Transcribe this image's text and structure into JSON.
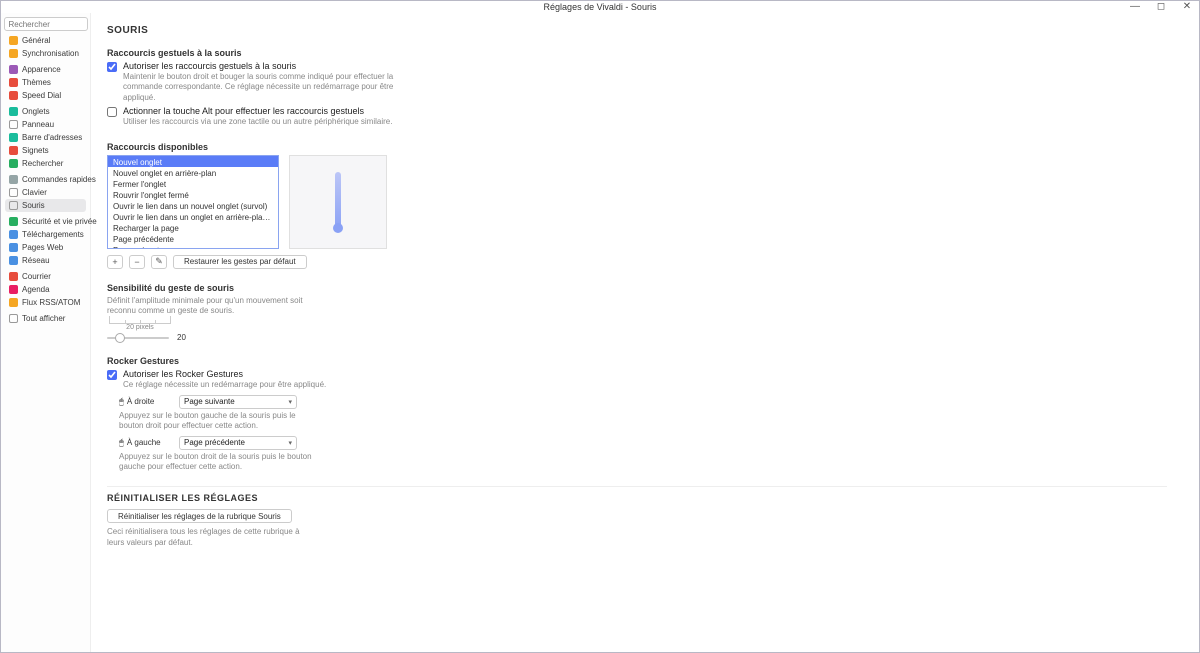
{
  "window": {
    "title": "Réglages de Vivaldi - Souris",
    "min": "—",
    "max": "◻",
    "close": "✕"
  },
  "sidebar": {
    "search_placeholder": "Rechercher",
    "groups": [
      {
        "items": [
          {
            "label": "Général",
            "icon": "ic-orange",
            "name": "general"
          },
          {
            "label": "Synchronisation",
            "icon": "ic-orange",
            "name": "sync"
          }
        ]
      },
      {
        "items": [
          {
            "label": "Apparence",
            "icon": "ic-purple",
            "name": "appearance"
          },
          {
            "label": "Thèmes",
            "icon": "ic-red",
            "name": "themes"
          },
          {
            "label": "Speed Dial",
            "icon": "ic-red",
            "name": "speed-dial"
          }
        ]
      },
      {
        "items": [
          {
            "label": "Onglets",
            "icon": "ic-teal",
            "name": "tabs"
          },
          {
            "label": "Panneau",
            "icon": "ic-outline",
            "name": "panel"
          },
          {
            "label": "Barre d'adresses",
            "icon": "ic-teal",
            "name": "address-bar"
          },
          {
            "label": "Signets",
            "icon": "ic-red",
            "name": "bookmarks"
          },
          {
            "label": "Rechercher",
            "icon": "ic-green",
            "name": "search"
          }
        ]
      },
      {
        "items": [
          {
            "label": "Commandes rapides",
            "icon": "ic-gray",
            "name": "quick-commands"
          },
          {
            "label": "Clavier",
            "icon": "ic-outline",
            "name": "keyboard"
          },
          {
            "label": "Souris",
            "icon": "ic-outline",
            "name": "mouse",
            "active": true
          }
        ]
      },
      {
        "items": [
          {
            "label": "Sécurité et vie privée",
            "icon": "ic-green",
            "name": "privacy"
          },
          {
            "label": "Téléchargements",
            "icon": "ic-blue",
            "name": "downloads"
          },
          {
            "label": "Pages Web",
            "icon": "ic-blue",
            "name": "webpages"
          },
          {
            "label": "Réseau",
            "icon": "ic-blue",
            "name": "network"
          }
        ]
      },
      {
        "items": [
          {
            "label": "Courrier",
            "icon": "ic-red",
            "name": "mail"
          },
          {
            "label": "Agenda",
            "icon": "ic-pink",
            "name": "calendar"
          },
          {
            "label": "Flux RSS/ATOM",
            "icon": "ic-orange",
            "name": "feeds"
          }
        ]
      },
      {
        "items": [
          {
            "label": "Tout afficher",
            "icon": "ic-outline",
            "name": "show-all"
          }
        ]
      }
    ]
  },
  "page": {
    "title": "SOURIS",
    "gestures_section": {
      "title": "Raccourcis gestuels à la souris",
      "allow": {
        "label": "Autoriser les raccourcis gestuels à la souris",
        "desc": "Maintenir le bouton droit et bouger la souris comme indiqué pour effectuer la commande correspondante. Ce réglage nécessite un redémarrage pour être appliqué.",
        "checked": true
      },
      "alt": {
        "label": "Actionner la touche Alt pour effectuer les raccourcis gestuels",
        "desc": "Utiliser les raccourcis via une zone tactile ou un autre périphérique similaire.",
        "checked": false
      }
    },
    "shortcuts_section": {
      "title": "Raccourcis disponibles",
      "items": [
        "Nouvel onglet",
        "Nouvel onglet en arrière-plan",
        "Fermer l'onglet",
        "Rouvrir l'onglet fermé",
        "Ouvrir le lien dans un nouvel onglet (survol)",
        "Ouvrir le lien dans un onglet en arrière-plan (au survol d'un lien)",
        "Recharger la page",
        "Page précédente",
        "Page suivante"
      ],
      "selected": 0,
      "add": "+",
      "remove": "−",
      "edit": "✎",
      "restore": "Restaurer les gestes par défaut"
    },
    "sensitivity_section": {
      "title": "Sensibilité du geste de souris",
      "desc": "Définit l'amplitude minimale pour qu'un mouvement soit reconnu comme un geste de souris.",
      "unit_label": "20 pixels",
      "value": 20
    },
    "rocker_section": {
      "title": "Rocker Gestures",
      "allow": {
        "label": "Autoriser les Rocker Gestures",
        "desc": "Ce réglage nécessite un redémarrage pour être appliqué.",
        "checked": true
      },
      "right": {
        "icon": "🖱",
        "label": "À droite",
        "value": "Page suivante",
        "desc": "Appuyez sur le bouton gauche de la souris puis le bouton droit pour effectuer cette action."
      },
      "left": {
        "icon": "🖱",
        "label": "À gauche",
        "value": "Page précédente",
        "desc": "Appuyez sur le bouton droit de la souris puis le bouton gauche pour effectuer cette action."
      }
    },
    "reset_section": {
      "title": "RÉINITIALISER LES RÉGLAGES",
      "button": "Réinitialiser les réglages de la rubrique Souris",
      "desc": "Ceci réinitialisera tous les réglages de cette rubrique à leurs valeurs par défaut."
    }
  }
}
